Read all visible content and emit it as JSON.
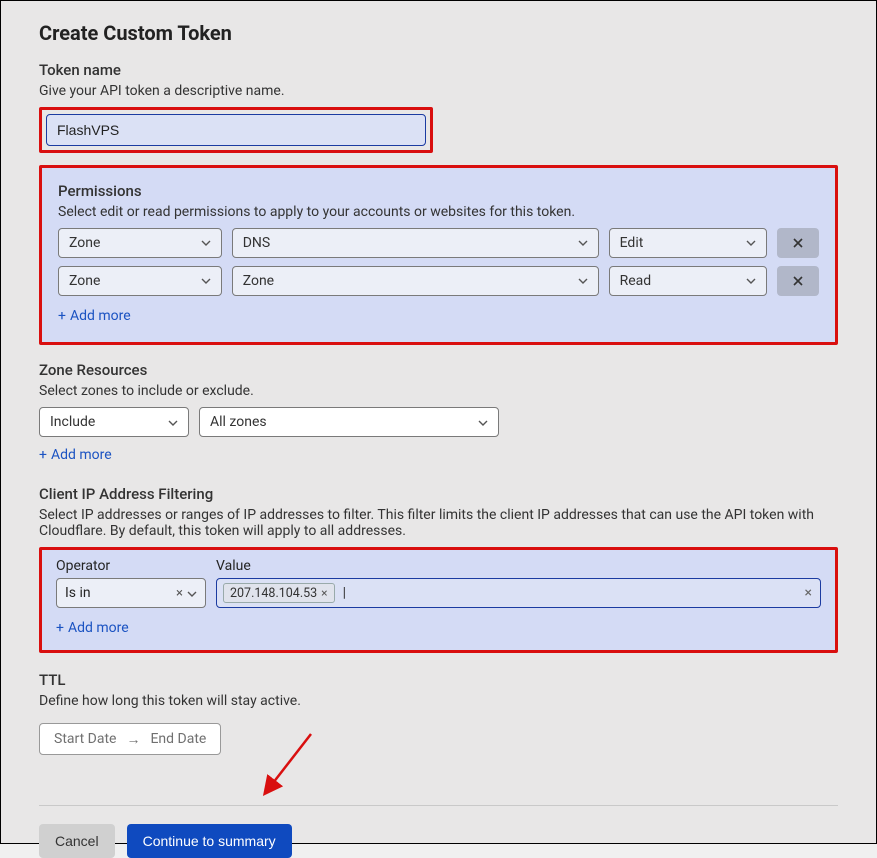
{
  "title": "Create Custom Token",
  "tokenName": {
    "heading": "Token name",
    "sub": "Give your API token a descriptive name.",
    "value": "FlashVPS"
  },
  "permissions": {
    "heading": "Permissions",
    "sub": "Select edit or read permissions to apply to your accounts or websites for this token.",
    "rows": [
      {
        "scope": "Zone",
        "resource": "DNS",
        "action": "Edit"
      },
      {
        "scope": "Zone",
        "resource": "Zone",
        "action": "Read"
      }
    ],
    "addMore": "Add more"
  },
  "zoneResources": {
    "heading": "Zone Resources",
    "sub": "Select zones to include or exclude.",
    "op": "Include",
    "zones": "All zones",
    "addMore": "Add more"
  },
  "ipFilter": {
    "heading": "Client IP Address Filtering",
    "sub": "Select IP addresses or ranges of IP addresses to filter. This filter limits the client IP addresses that can use the API token with Cloudflare. By default, this token will apply to all addresses.",
    "opLabel": "Operator",
    "valLabel": "Value",
    "operator": "Is in",
    "chip": "207.148.104.53",
    "addMore": "Add more"
  },
  "ttl": {
    "heading": "TTL",
    "sub": "Define how long this token will stay active.",
    "start": "Start Date",
    "end": "End Date"
  },
  "footer": {
    "cancel": "Cancel",
    "continue": "Continue to summary"
  },
  "icons": {
    "plus": "+",
    "times": "×",
    "arrow": "→"
  }
}
